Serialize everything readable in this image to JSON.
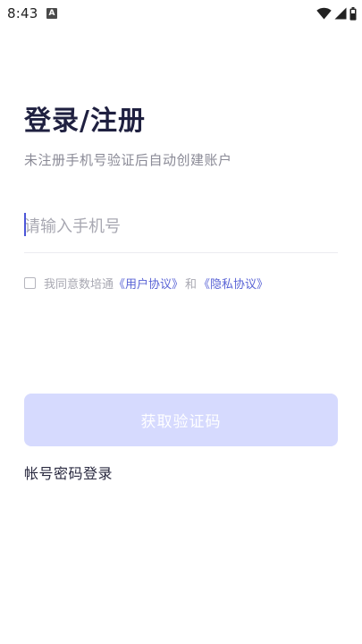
{
  "status_bar": {
    "time": "8:43",
    "notification_letter": "A",
    "icons": [
      "wifi-icon",
      "signal-icon",
      "battery-icon"
    ]
  },
  "login": {
    "title": "登录/注册",
    "subtitle": "未注册手机号验证后自动创建账户",
    "phone_placeholder": "请输入手机号",
    "phone_value": "",
    "agreement_prefix": "我同意数培通",
    "user_agreement": "《用户协议》",
    "and_text": "和",
    "privacy_agreement": "《隐私协议》",
    "agreement_checked": false,
    "get_code_button": "获取验证码",
    "account_login": "帐号密码登录"
  },
  "colors": {
    "title": "#1f2040",
    "link": "#5a64d6",
    "button_disabled_bg": "#d6dafe",
    "caret": "#4c56d8"
  }
}
